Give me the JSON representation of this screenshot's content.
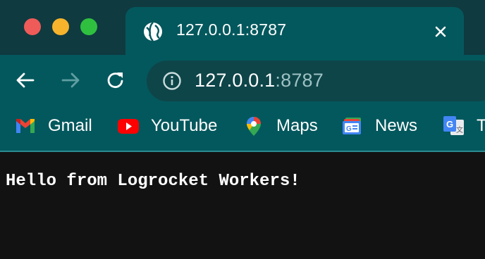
{
  "window": {
    "controls": [
      "close",
      "minimize",
      "maximize"
    ]
  },
  "tab": {
    "title": "127.0.0.1:8787",
    "icon": "globe-icon"
  },
  "toolbar": {
    "back_icon": "back-arrow-icon",
    "forward_icon": "forward-arrow-icon",
    "reload_icon": "reload-icon",
    "address": {
      "host": "127.0.0.1",
      "port": ":8787",
      "site_info_icon": "info-icon"
    }
  },
  "bookmarks": [
    {
      "label": "Gmail",
      "icon": "gmail-icon"
    },
    {
      "label": "YouTube",
      "icon": "youtube-icon"
    },
    {
      "label": "Maps",
      "icon": "maps-icon"
    },
    {
      "label": "News",
      "icon": "news-icon"
    },
    {
      "label": "T",
      "icon": "translate-icon"
    }
  ],
  "page": {
    "body_text": "Hello from Logrocket Workers!"
  },
  "colors": {
    "tabstrip": "#0f3a40",
    "toolbar": "#03585d",
    "omnibox": "#0e4549",
    "content_bg": "#121212"
  }
}
